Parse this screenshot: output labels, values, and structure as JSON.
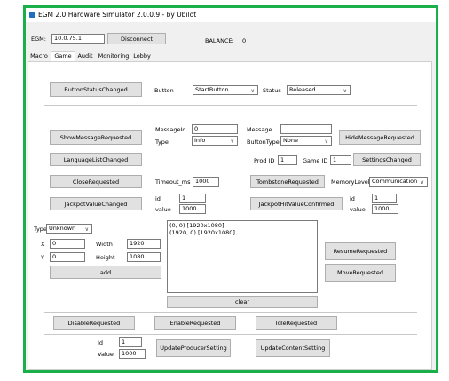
{
  "window": {
    "title": "EGM 2.0 Hardware Simulator 2.0.0.9  - by Ubilot"
  },
  "connection": {
    "egm_label": "EGM:",
    "egm_value": "10.0.75.1",
    "disconnect_label": "Disconnect",
    "balance_label": "BALANCE:",
    "balance_value": "0"
  },
  "tabs": [
    "Macro",
    "Game",
    "Audit",
    "Monitoring",
    "Lobby"
  ],
  "button_row": {
    "button_label": "ButtonStatusChanged",
    "field_label": "Button",
    "button_value": "StartButton",
    "status_label": "Status",
    "status_value": "Released"
  },
  "message_row": {
    "show_label": "ShowMessageRequested",
    "messageid_label": "MessageId",
    "messageid_value": "0",
    "type_label": "Type",
    "type_value": "Info",
    "message_label": "Message",
    "message_value": "",
    "buttontype_label": "ButtonType",
    "buttontype_value": "None",
    "hide_label": "HideMessageRequested"
  },
  "lang_row": {
    "language_label": "LanguageListChanged",
    "prodid_label": "Prod ID",
    "prodid_value": "1",
    "gameid_label": "Game ID",
    "gameid_value": "1",
    "settings_label": "SettingsChanged"
  },
  "close_row": {
    "close_label": "CloseRequested",
    "timeout_label": "Timeout_ms",
    "timeout_value": "1000",
    "tombstone_label": "TombstoneRequested",
    "memory_label": "MemoryLevel",
    "memory_value": "Communication"
  },
  "jackpot_row": {
    "jackpot_label": "JackpotValueChanged",
    "id_label": "id",
    "id_value": "1",
    "value_label": "value",
    "value_value": "1000",
    "hit_label": "JackpotHitValueConfirmed",
    "id2_label": "id",
    "id2_value": "1",
    "value2_label": "value",
    "value2_value": "1000"
  },
  "window_group": {
    "type_label": "Type",
    "type_value": "Unknown",
    "x_label": "X",
    "x_value": "0",
    "width_label": "Width",
    "width_value": "1920",
    "y_label": "Y",
    "y_value": "0",
    "height_label": "Height",
    "height_value": "1080",
    "add_label": "add",
    "list_items": [
      "(0, 0) [1920x1080]",
      "(1920, 0) [1920x1080]"
    ],
    "clear_label": "clear",
    "resume_label": "ResumeRequested",
    "move_label": "MoveRequested"
  },
  "state_row": {
    "disable_label": "DisableRequested",
    "enable_label": "EnableRequested",
    "idle_label": "IdleRequested"
  },
  "producer_row": {
    "id_label": "Id",
    "id_value": "1",
    "value_label": "Value",
    "value_value": "1000",
    "producer_label": "UpdateProducerSetting",
    "content_label": "UpdateContentSetting"
  },
  "colors": {
    "frame_border": "#19b04a"
  }
}
